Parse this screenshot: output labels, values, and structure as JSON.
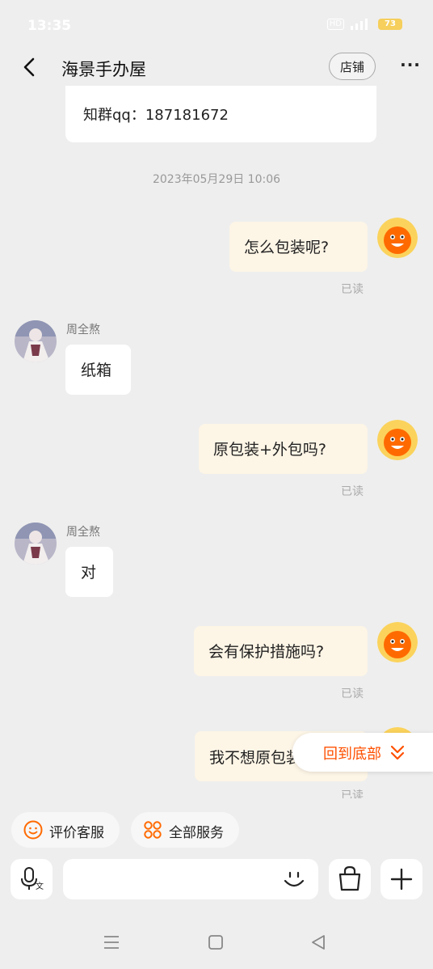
{
  "status_bar": {
    "time": "13:35",
    "hd": "HD",
    "battery": "73"
  },
  "header": {
    "title": "海景手办屋",
    "shop_label": "店铺",
    "more": "···"
  },
  "messages": {
    "previous_card_text": "知群qq：187181672",
    "timestamp": "2023年05月29日 10:06",
    "m1": "怎么包装呢?",
    "m1_read": "已读",
    "m2_sender": "周全熬",
    "m2": "纸箱",
    "m3": "原包装+外包吗?",
    "m3_read": "已读",
    "m4_sender": "周全熬",
    "m4": "对",
    "m5": "会有保护措施吗?",
    "m5_read": "已读",
    "m6": "我不想原包装更换",
    "m6_read": "已读"
  },
  "back_to_bottom": "回到底部",
  "quick_actions": {
    "rate": "评价客服",
    "services": "全部服务"
  },
  "input": {
    "placeholder": ""
  },
  "icons": {
    "back": "chevron-left-icon",
    "voice": "mic-translate-icon",
    "emoji": "smile-icon",
    "bag": "shopping-bag-icon",
    "plus": "plus-icon"
  },
  "colors": {
    "accent": "#ff5000",
    "right_bubble": "#fdf5e6",
    "background": "#eeeeee"
  }
}
